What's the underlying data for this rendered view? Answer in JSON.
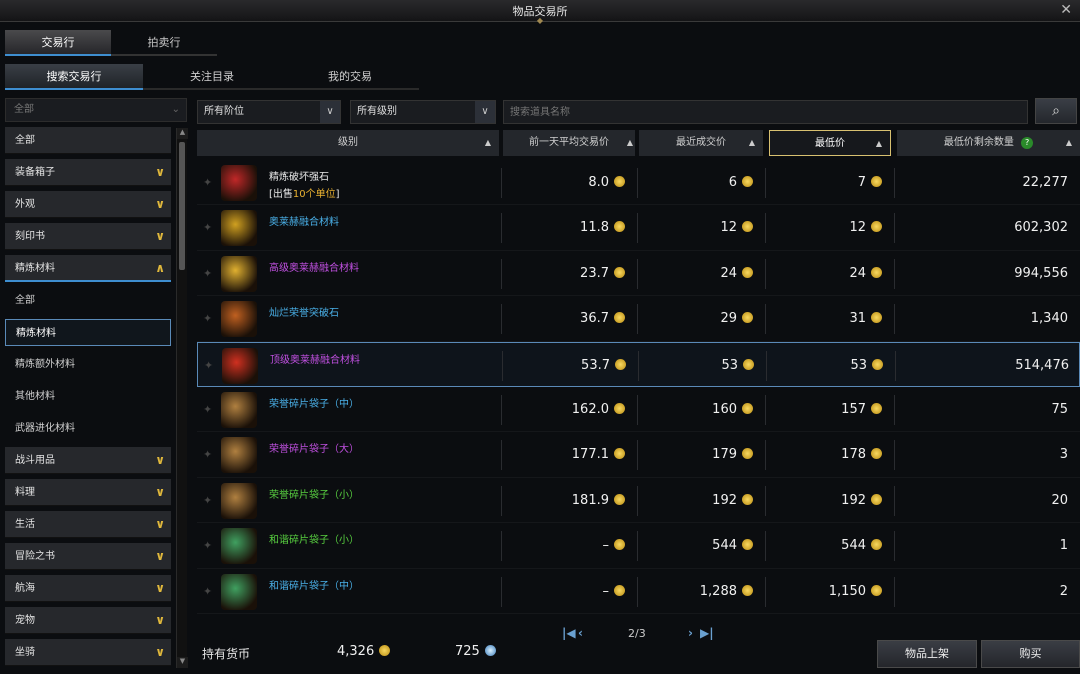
{
  "window": {
    "title": "物品交易所"
  },
  "main_tabs": [
    {
      "label": "交易行"
    },
    {
      "label": "拍卖行"
    }
  ],
  "sub_tabs": [
    {
      "label": "搜索交易行"
    },
    {
      "label": "关注目录"
    },
    {
      "label": "我的交易"
    }
  ],
  "sidebar": {
    "top_filter": "全部",
    "items": [
      {
        "label": "全部"
      },
      {
        "label": "装备箱子"
      },
      {
        "label": "外观"
      },
      {
        "label": "刻印书"
      },
      {
        "label": "精炼材料"
      },
      {
        "label": "全部"
      },
      {
        "label": "精炼材料"
      },
      {
        "label": "精炼额外材料"
      },
      {
        "label": "其他材料"
      },
      {
        "label": "武器进化材料"
      },
      {
        "label": "战斗用品"
      },
      {
        "label": "料理"
      },
      {
        "label": "生活"
      },
      {
        "label": "冒险之书"
      },
      {
        "label": "航海"
      },
      {
        "label": "宠物"
      },
      {
        "label": "坐骑"
      }
    ]
  },
  "filters": {
    "tier": "所有阶位",
    "grade": "所有级别",
    "search_placeholder": "搜索道具名称"
  },
  "table": {
    "headers": {
      "grade": "级别",
      "avg_price": "前一天平均交易价",
      "recent_price": "最近成交价",
      "lowest_price": "最低价",
      "lowest_qty": "最低价剩余数量"
    },
    "rows": [
      {
        "name": "精炼破坏强石",
        "name_color": "#e8e8e8",
        "icon_color": "#c02828",
        "note_prefix": "[出售",
        "note_gold": "10个单位",
        "note_suffix": "]",
        "avg": "8.0",
        "recent": "6",
        "lowest": "7",
        "qty": "22,277"
      },
      {
        "name": "奥莱赫融合材料",
        "name_color": "#4ab0e8",
        "icon_color": "#d0a020",
        "avg": "11.8",
        "recent": "12",
        "lowest": "12",
        "qty": "602,302"
      },
      {
        "name": "高级奥莱赫融合材料",
        "name_color": "#c050e0",
        "icon_color": "#e0b030",
        "avg": "23.7",
        "recent": "24",
        "lowest": "24",
        "qty": "994,556"
      },
      {
        "name": "灿烂荣誉突破石",
        "name_color": "#4ab0e8",
        "icon_color": "#c06020",
        "avg": "36.7",
        "recent": "29",
        "lowest": "31",
        "qty": "1,340"
      },
      {
        "name": "顶级奥莱赫融合材料",
        "name_color": "#c050e0",
        "icon_color": "#d03020",
        "avg": "53.7",
        "recent": "53",
        "lowest": "53",
        "qty": "514,476",
        "highlight": true
      },
      {
        "name": "荣誉碎片袋子（中）",
        "name_color": "#4ab0e8",
        "icon_color": "#b08040",
        "avg": "162.0",
        "recent": "160",
        "lowest": "157",
        "qty": "75"
      },
      {
        "name": "荣誉碎片袋子（大）",
        "name_color": "#c050e0",
        "icon_color": "#b08040",
        "avg": "177.1",
        "recent": "179",
        "lowest": "178",
        "qty": "3"
      },
      {
        "name": "荣誉碎片袋子（小）",
        "name_color": "#58d040",
        "icon_color": "#b08040",
        "avg": "181.9",
        "recent": "192",
        "lowest": "192",
        "qty": "20"
      },
      {
        "name": "和谐碎片袋子（小）",
        "name_color": "#58d040",
        "icon_color": "#40a060",
        "avg": "–",
        "recent": "544",
        "lowest": "544",
        "qty": "1"
      },
      {
        "name": "和谐碎片袋子（中）",
        "name_color": "#4ab0e8",
        "icon_color": "#40a060",
        "avg": "–",
        "recent": "1,288",
        "lowest": "1,150",
        "qty": "2"
      }
    ]
  },
  "pager": {
    "page": "2/3"
  },
  "footer": {
    "currency_label": "持有货币",
    "gold": "4,326",
    "crystal": "725"
  },
  "buttons": {
    "list_item": "物品上架",
    "buy": "购买"
  }
}
